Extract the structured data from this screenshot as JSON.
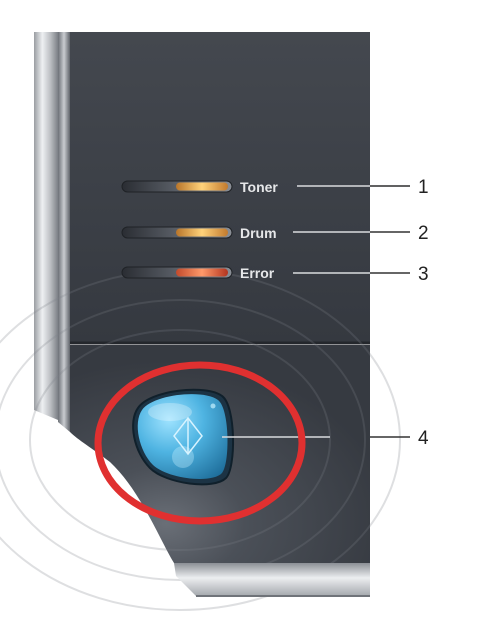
{
  "indicators": [
    {
      "label": "Toner",
      "callout": "1",
      "color": "#f0a54a"
    },
    {
      "label": "Drum",
      "callout": "2",
      "color": "#f0a54a"
    },
    {
      "label": "Error",
      "callout": "3",
      "color": "#e0493a"
    }
  ],
  "button": {
    "callout": "4",
    "icon": "go-icon",
    "color": "#5bb8e0"
  },
  "highlight_color": "#e03030",
  "panel_color": "#3b3f47"
}
